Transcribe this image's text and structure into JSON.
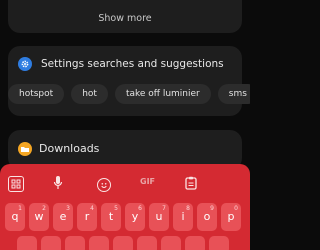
{
  "top_card": {
    "show_more": "Show more"
  },
  "settings_card": {
    "title": "Settings searches and suggestions",
    "icon": "gear-icon",
    "chips": [
      "hotspot",
      "hot",
      "take off luminier",
      "sms"
    ]
  },
  "downloads_card": {
    "title": "Downloads",
    "icon": "folder-icon"
  },
  "keyboard": {
    "toolbar": {
      "grid_icon": "keyboard-grid-icon",
      "mic_icon": "mic-icon",
      "emoji_icon": "emoji-icon",
      "gif_label": "GIF",
      "clipboard_icon": "clipboard-icon"
    },
    "row1": [
      {
        "ch": "q",
        "num": "1"
      },
      {
        "ch": "w",
        "num": "2"
      },
      {
        "ch": "e",
        "num": "3"
      },
      {
        "ch": "r",
        "num": "4"
      },
      {
        "ch": "t",
        "num": "5"
      },
      {
        "ch": "y",
        "num": "6"
      },
      {
        "ch": "u",
        "num": "7"
      },
      {
        "ch": "i",
        "num": "8"
      },
      {
        "ch": "o",
        "num": "9"
      },
      {
        "ch": "p",
        "num": "0"
      }
    ]
  },
  "colors": {
    "background": "#0b0b0b",
    "card": "#1e1e1e",
    "chip": "#2c2c2c",
    "keyboard": "#d42a32",
    "key": "#e85157",
    "gear": "#2f7de1",
    "folder": "#f5a623"
  }
}
